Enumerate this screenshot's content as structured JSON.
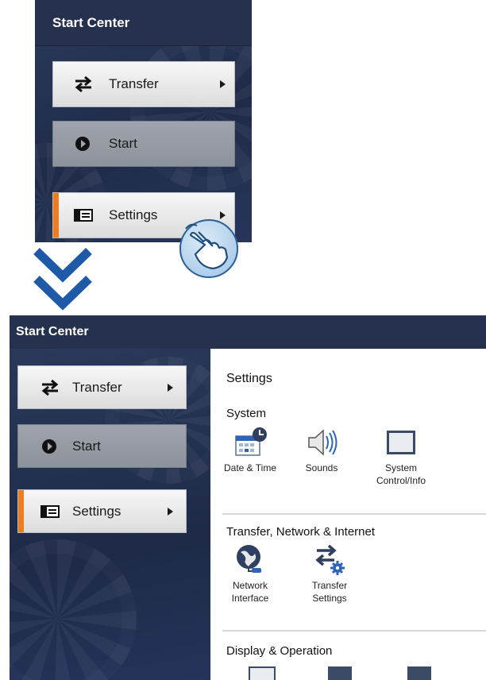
{
  "top_panel": {
    "header": "Start Center",
    "buttons": [
      {
        "label": "Transfer",
        "icon": "transfer-arrows-icon",
        "has_submenu": true,
        "state": "normal"
      },
      {
        "label": "Start",
        "icon": "play-circle-icon",
        "has_submenu": false,
        "state": "disabled"
      },
      {
        "label": "Settings",
        "icon": "settings-panel-icon",
        "has_submenu": true,
        "state": "selected"
      }
    ]
  },
  "bottom_panel": {
    "header": "Start Center",
    "buttons": [
      {
        "label": "Transfer",
        "icon": "transfer-arrows-icon",
        "has_submenu": true,
        "state": "normal"
      },
      {
        "label": "Start",
        "icon": "play-circle-icon",
        "has_submenu": false,
        "state": "disabled"
      },
      {
        "label": "Settings",
        "icon": "settings-panel-icon",
        "has_submenu": true,
        "state": "selected"
      }
    ],
    "settings": {
      "title": "Settings",
      "sections": [
        {
          "title": "System",
          "items": [
            {
              "label": "Date & Time",
              "icon": "calendar-clock-icon"
            },
            {
              "label": "Sounds",
              "icon": "speaker-icon"
            },
            {
              "label": "System Control/Info",
              "icon": "system-window-icon"
            }
          ]
        },
        {
          "title": "Transfer, Network & Internet",
          "items": [
            {
              "label": "Network Interface",
              "icon": "globe-network-icon"
            },
            {
              "label": "Transfer Settings",
              "icon": "transfer-gear-icon"
            }
          ]
        },
        {
          "title": "Display & Operation",
          "items": []
        }
      ]
    }
  },
  "colors": {
    "header_bg": "#26324d",
    "panel_bg": "#1f2b48",
    "accent": "#f07d1d",
    "arrow": "#1e5aa8"
  }
}
